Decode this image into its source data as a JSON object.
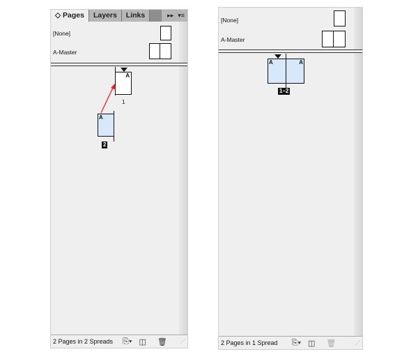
{
  "left": {
    "tabs": [
      {
        "label": "◇ Pages",
        "active": true
      },
      {
        "label": "Layers"
      },
      {
        "label": "Links"
      }
    ],
    "tab_controls": {
      "collapse": "▸▸",
      "menu": "▾≡"
    },
    "masters": [
      {
        "label": "[None]"
      },
      {
        "label": "A-Master"
      }
    ],
    "pages": [
      {
        "number": "1",
        "master": "A"
      },
      {
        "number": "2",
        "master": "A",
        "selected": true
      }
    ],
    "arrow_color": "#e8212b",
    "footer": {
      "status": "2 Pages in 2 Spreads"
    }
  },
  "right": {
    "masters": [
      {
        "label": "[None]"
      },
      {
        "label": "A-Master"
      }
    ],
    "spread": {
      "label": "1–2",
      "left_master": "A",
      "right_master": "A",
      "selected": true
    },
    "footer": {
      "status": "2 Pages in 1 Spread"
    }
  },
  "icons": {
    "new_page": "new-page-icon",
    "trash": "trash-icon",
    "edit_size": "edit-page-size-icon"
  }
}
